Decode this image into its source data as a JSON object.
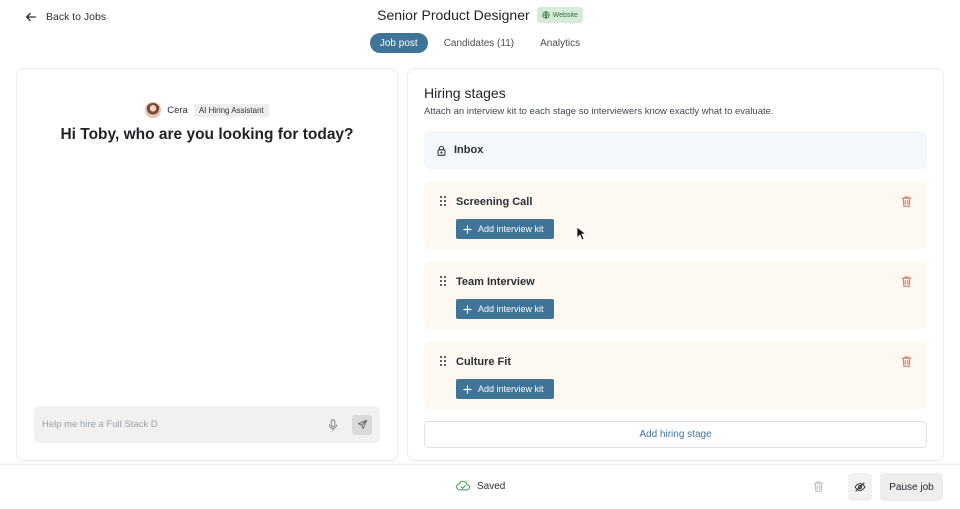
{
  "header": {
    "back_label": "Back to Jobs",
    "job_title": "Senior Product Designer",
    "badge": "Website"
  },
  "tabs": [
    {
      "label": "Job post",
      "active": true
    },
    {
      "label": "Candidates (11)",
      "active": false
    },
    {
      "label": "Analytics",
      "active": false
    }
  ],
  "assistant": {
    "name": "Cera",
    "tag": "AI Hiring Assistant",
    "greeting": "Hi Toby, who are you looking for today?",
    "input_value": "Help me hire a Full Stack D"
  },
  "hiring": {
    "title": "Hiring stages",
    "subtitle": "Attach an interview kit to each stage so interviewers know exactly what to evaluate.",
    "inbox_label": "Inbox",
    "stages": [
      {
        "name": "Screening Call",
        "button": "Add interview kit"
      },
      {
        "name": "Team Interview",
        "button": "Add interview kit"
      },
      {
        "name": "Culture Fit",
        "button": "Add interview kit"
      }
    ],
    "add_stage_label": "Add hiring stage"
  },
  "footer": {
    "status": "Saved",
    "pause_label": "Pause job"
  },
  "colors": {
    "accent": "#3f7496",
    "stage_bg": "#fdf8f1",
    "inbox_bg": "#f4f8fb",
    "delete": "#d9736a",
    "badge_bg": "#d6ecd9"
  },
  "icons": [
    "arrow-left-icon",
    "globe-icon",
    "mic-icon",
    "send-icon",
    "lock-icon",
    "drag-handle-icon",
    "trash-icon",
    "plus-icon",
    "cloud-check-icon",
    "eye-off-icon",
    "cursor-icon"
  ]
}
